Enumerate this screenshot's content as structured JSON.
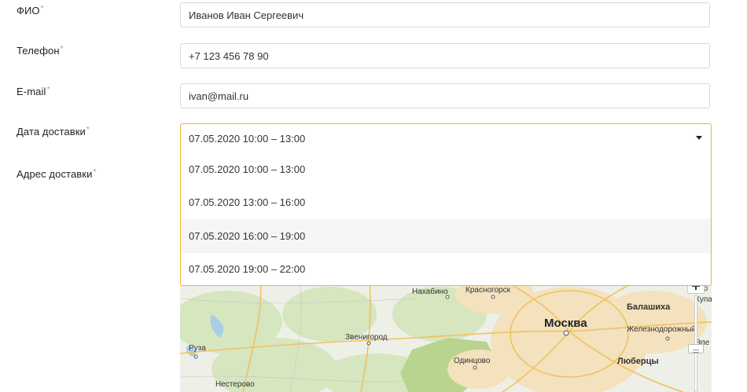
{
  "form": {
    "required_mark": "*",
    "fio": {
      "label": "ФИО",
      "value": "Иванов Иван Сергеевич"
    },
    "phone": {
      "label": "Телефон",
      "value": "+7 123 456 78 90"
    },
    "email": {
      "label": "E-mail",
      "value": "ivan@mail.ru"
    },
    "delivery_date": {
      "label": "Дата доставки",
      "selected": "07.05.2020 10:00 – 13:00",
      "options": [
        "07.05.2020 10:00 – 13:00",
        "07.05.2020 13:00 – 16:00",
        "07.05.2020 16:00 – 19:00",
        "07.05.2020 19:00 – 22:00"
      ],
      "hovered_index": 2
    },
    "delivery_address": {
      "label": "Адрес доставки"
    }
  },
  "map": {
    "labels": {
      "nakhabino": "Нахабино",
      "krasnogorsk": "Красногорск",
      "balashikha": "Балашиха",
      "moskva": "Москва",
      "zheleznodorozhny": "Железнодорожный",
      "zvenigorod": "Звенигород",
      "ruza": "Руза",
      "odintsovo": "Одинцово",
      "lyubertsy": "Люберцы",
      "nesterovo": "Нестерово",
      "kupa_fragment": "Купа",
      "ele_fragment": "Эле",
      "top_fragment": "ар"
    },
    "colors": {
      "background": "#eef0e8",
      "forest": "#cfe0b4",
      "city": "#f2dfb8",
      "roads": "#f3c15a",
      "water": "#a9cde8"
    }
  },
  "accent_color": "#f0b430",
  "required_color": "#e8883a"
}
